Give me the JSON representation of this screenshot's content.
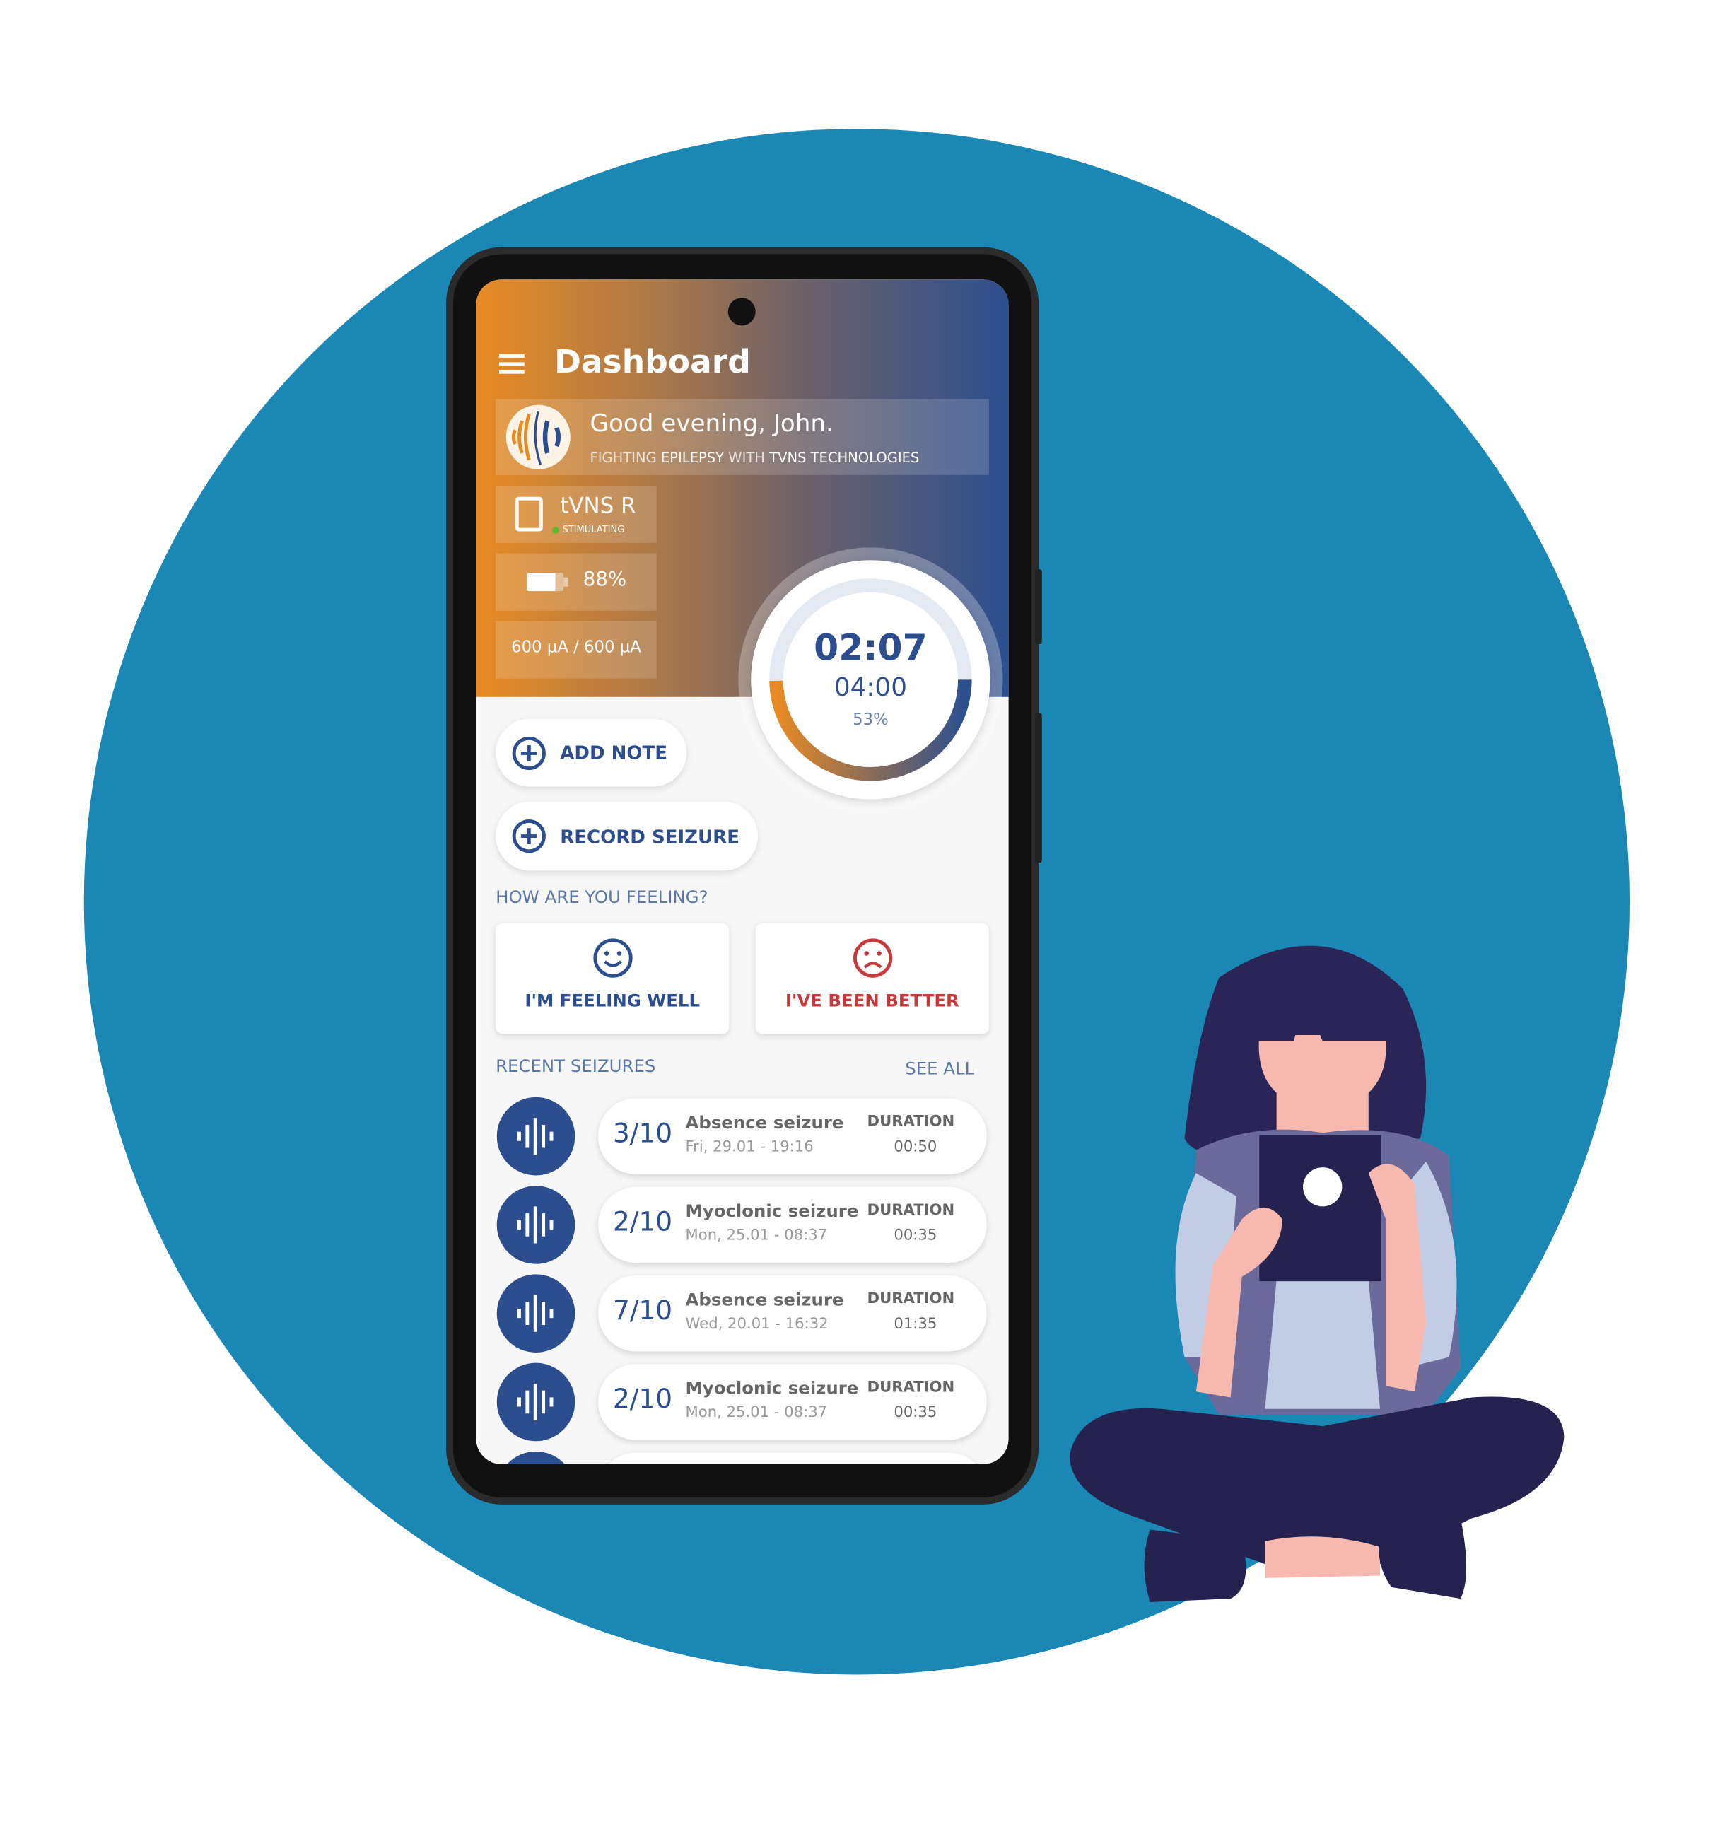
{
  "app": {
    "title": "Dashboard",
    "menu_icon": "hamburger-icon"
  },
  "colors": {
    "primary": "#2c4d8e",
    "accent_orange": "#e88b23",
    "danger": "#c6393b",
    "background_circle": "#1b87b4",
    "status_green": "#5dbb2c"
  },
  "greeting": {
    "text": "Good evening, John.",
    "sub_1": "FIGHTING ",
    "sub_2": "EPILEPSY",
    "sub_3": " WITH ",
    "sub_4": "TVNS TECHNOLOGIES"
  },
  "device": {
    "name": "tVNS R",
    "status": "STIMULATING",
    "battery": "88%",
    "battery_level": 88,
    "current": "600 µA / 600 µA"
  },
  "timer": {
    "elapsed": "02:07",
    "total": "04:00",
    "percent": "53%",
    "progress": 0.53
  },
  "actions": {
    "add_note": "ADD NOTE",
    "record_seizure": "RECORD SEIZURE"
  },
  "feeling": {
    "label": "HOW ARE YOU FEELING?",
    "well": "I'M FEELING WELL",
    "bad": "I'VE BEEN BETTER"
  },
  "recent": {
    "label": "RECENT SEIZURES",
    "see_all": "SEE ALL",
    "items": [
      {
        "severity": "3/10",
        "type": "Absence seizure",
        "date": "Fri, 29.01 - 19:16",
        "duration_label": "DURATION",
        "duration": "00:50"
      },
      {
        "severity": "2/10",
        "type": "Myoclonic seizure",
        "date": "Mon, 25.01 - 08:37",
        "duration_label": "DURATION",
        "duration": "00:35"
      },
      {
        "severity": "7/10",
        "type": "Absence seizure",
        "date": "Wed, 20.01 - 16:32",
        "duration_label": "DURATION",
        "duration": "01:35"
      },
      {
        "severity": "2/10",
        "type": "Myoclonic seizure",
        "date": "Mon, 25.01 - 08:37",
        "duration_label": "DURATION",
        "duration": "00:35"
      }
    ]
  }
}
